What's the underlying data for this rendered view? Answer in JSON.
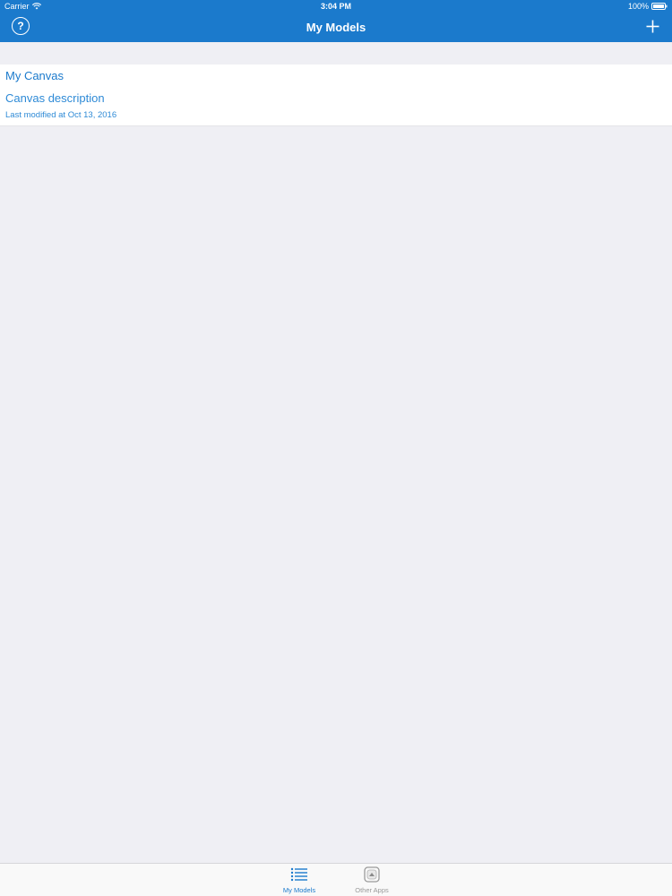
{
  "status_bar": {
    "carrier": "Carrier",
    "time": "3:04 PM",
    "battery": "100%"
  },
  "nav": {
    "title": "My Models",
    "help_icon": "question-circle-icon",
    "add_icon": "plus-icon"
  },
  "models": [
    {
      "title": "My Canvas",
      "description": "Canvas description",
      "modified": "Last modified at Oct 13, 2016"
    }
  ],
  "tabs": [
    {
      "label": "My Models",
      "icon": "list-icon",
      "selected": true
    },
    {
      "label": "Other Apps",
      "icon": "apps-icon",
      "selected": false
    }
  ],
  "colors": {
    "accent": "#1b7acc",
    "background": "#efeff4",
    "inactive_tab": "#9a9a9a"
  }
}
